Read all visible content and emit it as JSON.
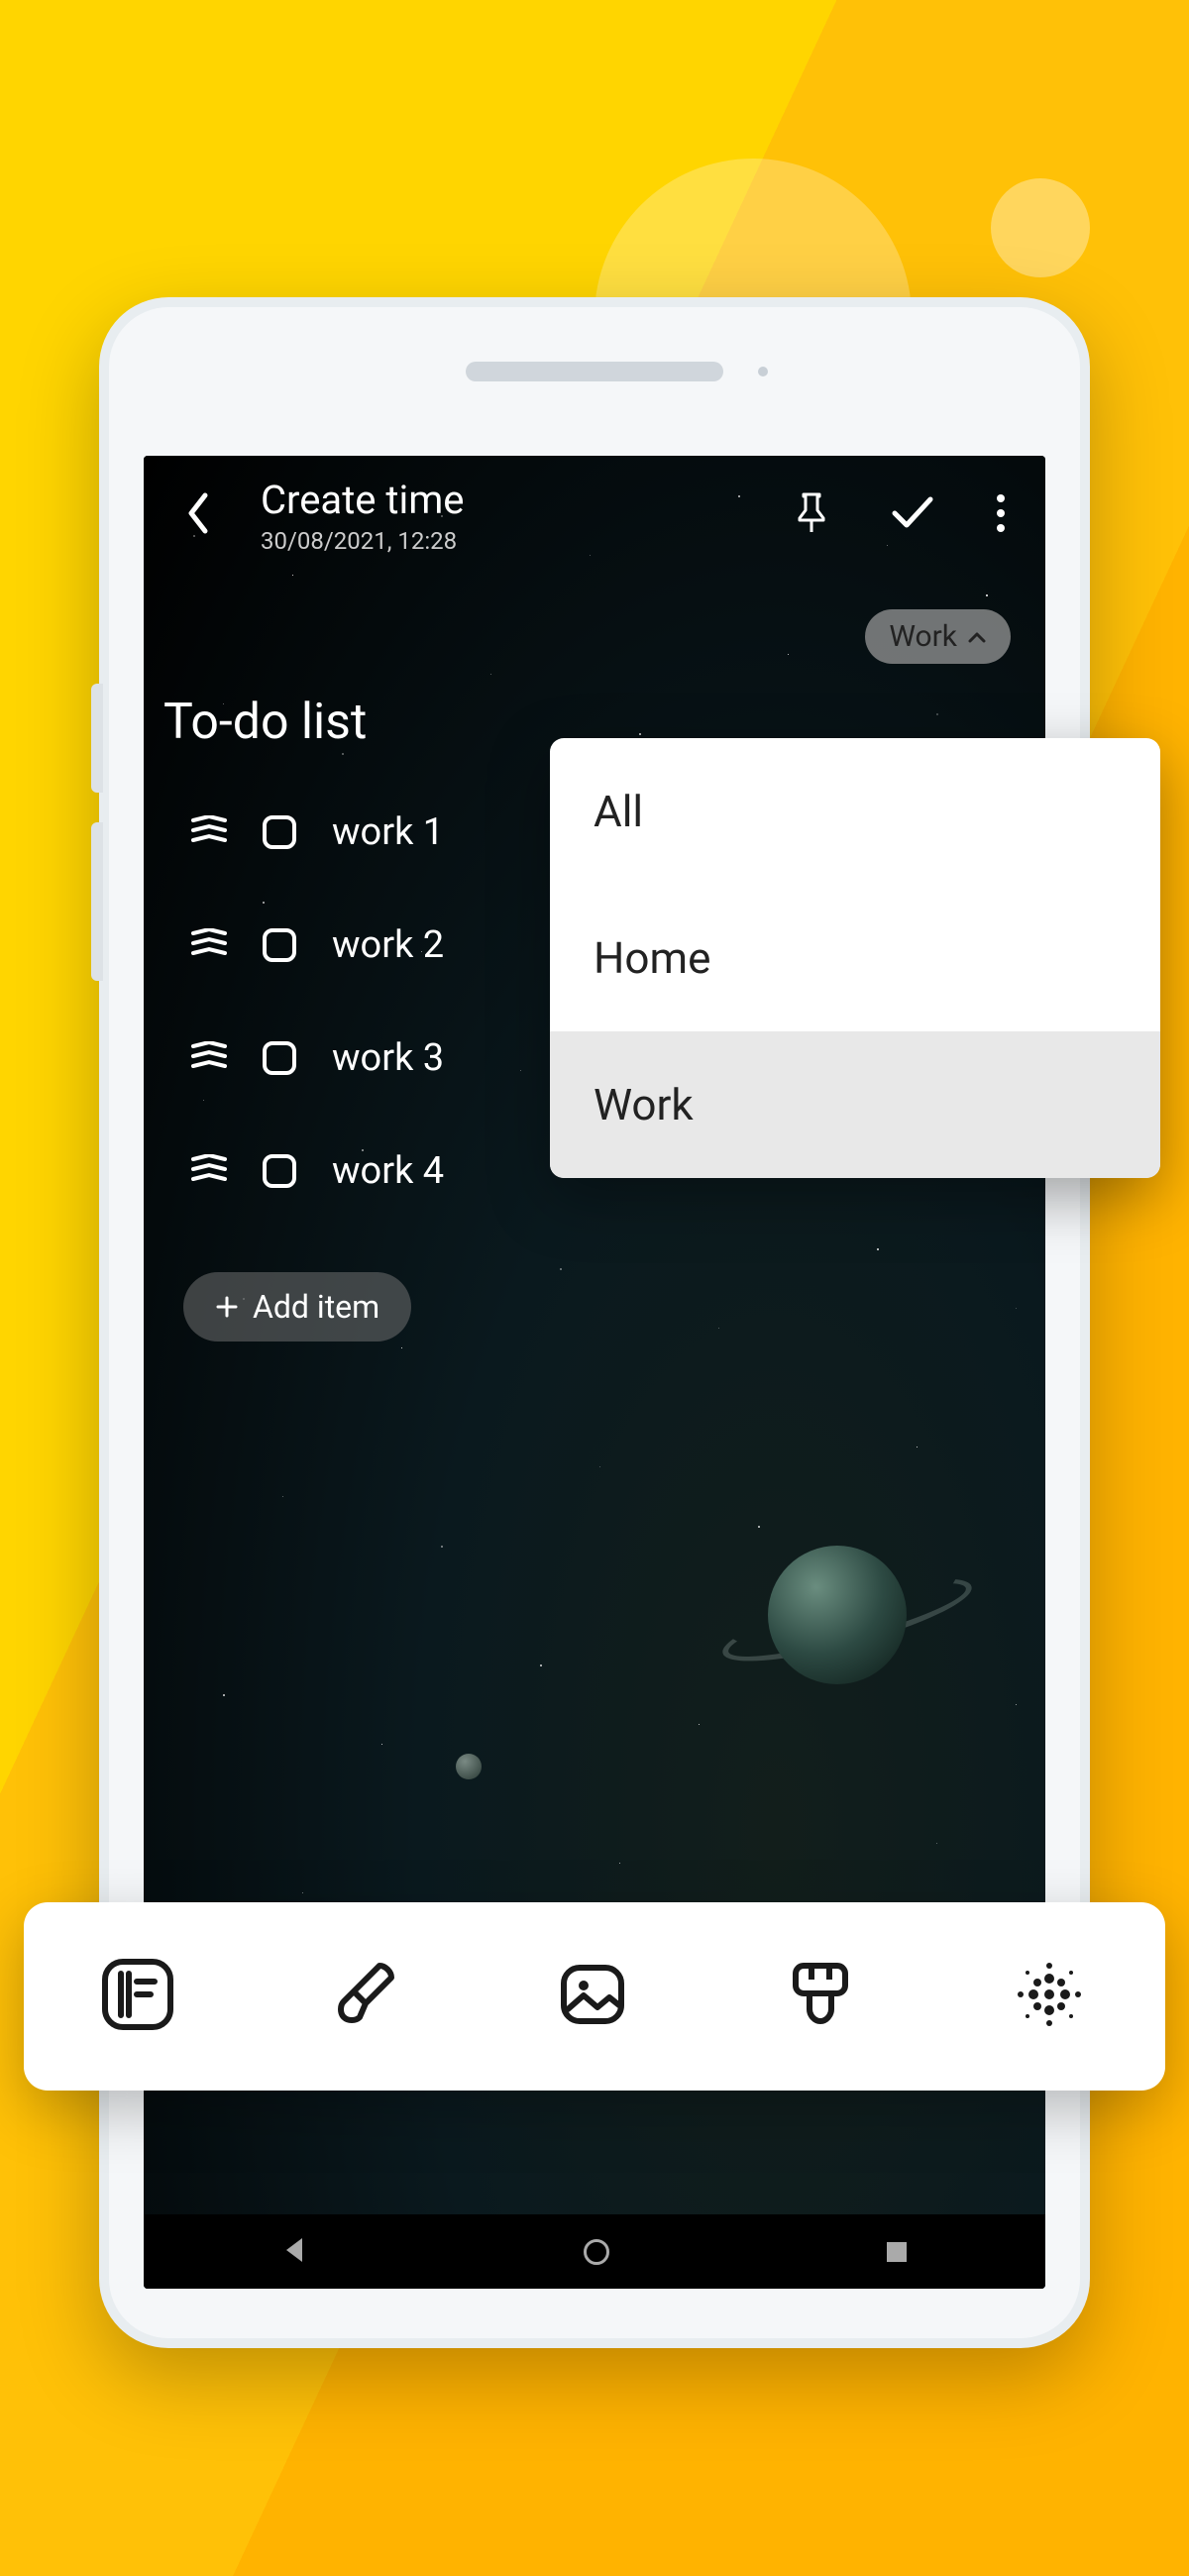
{
  "header": {
    "title": "Create time",
    "subtitle": "30/08/2021, 12:28"
  },
  "category": {
    "selected": "Work",
    "options": [
      "All",
      "Home",
      "Work"
    ]
  },
  "list": {
    "title": "To-do list",
    "items": [
      "work 1",
      "work 2",
      "work 3",
      "work 4"
    ],
    "add_label": "Add item"
  }
}
